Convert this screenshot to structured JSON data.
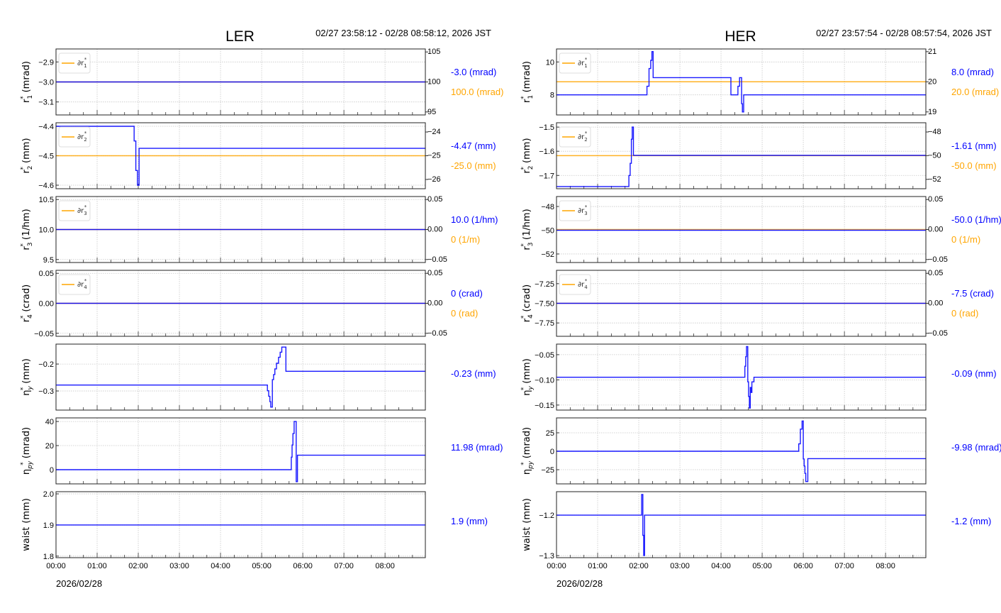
{
  "colors": {
    "value": "#0000ff",
    "reference": "#ffa500",
    "grid": "#c8c8c8"
  },
  "chart_data": [
    {
      "type": "line",
      "title": "LER",
      "time_range": "02/27 23:58:12 - 02/28 08:58:12, 2026 JST",
      "date_label": "2026/02/28",
      "xlim_hours": [
        0,
        8.98
      ],
      "xticks": [
        0,
        1,
        2,
        3,
        4,
        5,
        6,
        7,
        8
      ],
      "xticklabels": [
        "00:00",
        "01:00",
        "02:00",
        "03:00",
        "04:00",
        "05:00",
        "06:00",
        "07:00",
        "08:00"
      ],
      "panels": [
        {
          "ylabel": {
            "sym": "r",
            "sub": "1",
            "sup": "*",
            "unit": "(mrad)"
          },
          "ylim": [
            -3.165,
            -2.835
          ],
          "yticks": [
            -3.1,
            -3.0,
            -2.9
          ],
          "yticklabels": [
            "−3.1",
            "−3.0",
            "−2.9"
          ],
          "y2lim": [
            94.5,
            105.5
          ],
          "y2ticks": [
            95,
            100,
            105
          ],
          "y2ticklabels": [
            "95",
            "100",
            "105"
          ],
          "legend": {
            "sym": "∂r",
            "sub": "1",
            "sup": "*"
          },
          "value_series": [
            [
              0,
              -3.0
            ]
          ],
          "reference_value": 100,
          "readouts": [
            "-3.0 (mrad)",
            "100.0 (mrad)"
          ]
        },
        {
          "ylabel": {
            "sym": "r",
            "sub": "2",
            "sup": "*",
            "unit": "(mm)"
          },
          "ylim": [
            -4.612,
            -4.388
          ],
          "yticks": [
            -4.6,
            -4.5,
            -4.4
          ],
          "yticklabels": [
            "−4.6",
            "−4.5",
            "−4.4"
          ],
          "y2lim": [
            -26.39,
            -23.61
          ],
          "y2ticks": [
            -26,
            -25,
            -24
          ],
          "y2ticklabels": [
            "−26",
            "−25",
            "−24"
          ],
          "legend": {
            "sym": "∂r",
            "sub": "2",
            "sup": "*"
          },
          "value_series": [
            [
              0,
              -4.4
            ],
            [
              1.9,
              -4.45
            ],
            [
              1.94,
              -4.55
            ],
            [
              1.98,
              -4.6
            ],
            [
              2.02,
              -4.475
            ]
          ],
          "reference_value": -25,
          "readouts": [
            "-4.47 (mm)",
            "-25.0 (mm)"
          ]
        },
        {
          "ylabel": {
            "sym": "r",
            "sub": "3",
            "sup": "*",
            "unit": "(1/hm)"
          },
          "ylim": [
            9.45,
            10.55
          ],
          "yticks": [
            9.5,
            10.0,
            10.5
          ],
          "yticklabels": [
            "9.5",
            "10.0",
            "10.5"
          ],
          "y2lim": [
            -0.055,
            0.055
          ],
          "y2ticks": [
            -0.05,
            0,
            0.05
          ],
          "y2ticklabels": [
            "−0.05",
            "0.00",
            "0.05"
          ],
          "legend": {
            "sym": "∂r",
            "sub": "3",
            "sup": "*"
          },
          "value_series": [
            [
              0,
              10.0
            ]
          ],
          "reference_value": 0,
          "readouts": [
            "10.0 (1/hm)",
            "0 (1/m)"
          ]
        },
        {
          "ylabel": {
            "sym": "r",
            "sub": "4",
            "sup": "*",
            "unit": "(crad)"
          },
          "ylim": [
            -0.055,
            0.055
          ],
          "yticks": [
            -0.05,
            0,
            0.05
          ],
          "yticklabels": [
            "−0.05",
            "0.00",
            "0.05"
          ],
          "y2lim": [
            -0.055,
            0.055
          ],
          "y2ticks": [
            -0.05,
            0,
            0.05
          ],
          "y2ticklabels": [
            "−0.05",
            "0.00",
            "0.05"
          ],
          "legend": {
            "sym": "∂r",
            "sub": "4",
            "sup": "*"
          },
          "value_series": [
            [
              0,
              0
            ]
          ],
          "reference_value": 0,
          "readouts": [
            "0 (crad)",
            "0 (rad)"
          ]
        },
        {
          "ylabel": {
            "sym": "η",
            "sub": "y",
            "sup": "*",
            "unit": "(mm)"
          },
          "ylim": [
            -0.371,
            -0.126
          ],
          "yticks": [
            -0.3,
            -0.2
          ],
          "yticklabels": [
            "−0.3",
            "−0.2"
          ],
          "value_series": [
            [
              0,
              -0.278
            ],
            [
              5.14,
              -0.299
            ],
            [
              5.17,
              -0.32
            ],
            [
              5.2,
              -0.34
            ],
            [
              5.22,
              -0.36
            ],
            [
              5.26,
              -0.258
            ],
            [
              5.29,
              -0.239
            ],
            [
              5.32,
              -0.218
            ],
            [
              5.36,
              -0.197
            ],
            [
              5.41,
              -0.175
            ],
            [
              5.45,
              -0.156
            ],
            [
              5.49,
              -0.137
            ],
            [
              5.59,
              -0.227
            ]
          ],
          "readouts": [
            "-0.23 (mm)"
          ]
        },
        {
          "ylabel": {
            "sym": "η",
            "sub": "py",
            "sup": "*",
            "unit": "(mrad)"
          },
          "ylim": [
            -11.8,
            43
          ],
          "yticks": [
            0,
            20,
            40
          ],
          "yticklabels": [
            "0",
            "20",
            "40"
          ],
          "value_series": [
            [
              0,
              0
            ],
            [
              5.72,
              10.4
            ],
            [
              5.74,
              20.5
            ],
            [
              5.76,
              30
            ],
            [
              5.79,
              40
            ],
            [
              5.84,
              -10
            ],
            [
              5.87,
              11.98
            ]
          ],
          "readouts": [
            "11.98 (mrad)"
          ]
        },
        {
          "ylabel": {
            "sym": "waist",
            "sub": "",
            "sup": "",
            "unit": "(mm)"
          },
          "ylim": [
            1.795,
            2.007
          ],
          "yticks": [
            1.8,
            1.9,
            2.0
          ],
          "yticklabels": [
            "1.8",
            "1.9",
            "2.0"
          ],
          "value_series": [
            [
              0,
              1.9
            ]
          ],
          "readouts": [
            "1.9 (mm)"
          ]
        }
      ]
    },
    {
      "type": "line",
      "title": "HER",
      "time_range": "02/27 23:57:54 - 02/28 08:57:54, 2026 JST",
      "date_label": "2026/02/28",
      "xlim_hours": [
        0,
        8.98
      ],
      "xticks": [
        0,
        1,
        2,
        3,
        4,
        5,
        6,
        7,
        8
      ],
      "xticklabels": [
        "00:00",
        "01:00",
        "02:00",
        "03:00",
        "04:00",
        "05:00",
        "06:00",
        "07:00",
        "08:00"
      ],
      "panels": [
        {
          "ylabel": {
            "sym": "r",
            "sub": "1",
            "sup": "*",
            "unit": "(mrad)"
          },
          "ylim": [
            6.78,
            10.79
          ],
          "yticks": [
            8,
            10
          ],
          "yticklabels": [
            "8",
            "10"
          ],
          "y2lim": [
            18.9,
            21.09
          ],
          "y2ticks": [
            19,
            20,
            21
          ],
          "y2ticklabels": [
            "19",
            "20",
            "21"
          ],
          "legend": {
            "sym": "∂r",
            "sub": "1",
            "sup": "*"
          },
          "value_series": [
            [
              0,
              8
            ],
            [
              2.2,
              8.52
            ],
            [
              2.25,
              9.6
            ],
            [
              2.29,
              10.1
            ],
            [
              2.32,
              10.63
            ],
            [
              2.35,
              9.05
            ],
            [
              4.24,
              8
            ],
            [
              4.41,
              8.52
            ],
            [
              4.45,
              9.05
            ],
            [
              4.5,
              7.46
            ],
            [
              4.52,
              6.96
            ],
            [
              4.55,
              8
            ]
          ],
          "reference_value": 20,
          "readouts": [
            "8.0 (mrad)",
            "20.0 (mrad)"
          ]
        },
        {
          "ylabel": {
            "sym": "r",
            "sub": "2",
            "sup": "*",
            "unit": "(mm)"
          },
          "ylim": [
            -1.755,
            -1.482
          ],
          "yticks": [
            -1.7,
            -1.6,
            -1.5
          ],
          "yticklabels": [
            "−1.7",
            "−1.6",
            "−1.5"
          ],
          "y2lim": [
            -52.79,
            -47.22
          ],
          "y2ticks": [
            -52,
            -50,
            -48
          ],
          "y2ticklabels": [
            "−52",
            "−50",
            "−48"
          ],
          "legend": {
            "sym": "∂r",
            "sub": "2",
            "sup": "*"
          },
          "value_series": [
            [
              0,
              -1.746
            ],
            [
              1.76,
              -1.7
            ],
            [
              1.79,
              -1.65
            ],
            [
              1.82,
              -1.55
            ],
            [
              1.84,
              -1.5
            ],
            [
              1.87,
              -1.617
            ]
          ],
          "reference_value": -50,
          "readouts": [
            "-1.61 (mm)",
            "-50.0 (mm)"
          ]
        },
        {
          "ylabel": {
            "sym": "r",
            "sub": "3",
            "sup": "*",
            "unit": "(1/hm)"
          },
          "ylim": [
            -52.72,
            -47.16
          ],
          "yticks": [
            -52,
            -50,
            -48
          ],
          "yticklabels": [
            "−52",
            "−50",
            "−48"
          ],
          "y2lim": [
            -0.055,
            0.055
          ],
          "y2ticks": [
            -0.05,
            0,
            0.05
          ],
          "y2ticklabels": [
            "−0.05",
            "0.00",
            "0.05"
          ],
          "legend": {
            "sym": "∂r",
            "sub": "3",
            "sup": "*"
          },
          "value_series": [
            [
              0,
              -50
            ]
          ],
          "reference_value": 0,
          "readouts": [
            "-50.0 (1/hm)",
            "0 (1/m)"
          ]
        },
        {
          "ylabel": {
            "sym": "r",
            "sub": "4",
            "sup": "*",
            "unit": "(crad)"
          },
          "ylim": [
            -7.92,
            -7.08
          ],
          "yticks": [
            -7.75,
            -7.5,
            -7.25
          ],
          "yticklabels": [
            "−7.75",
            "−7.50",
            "−7.25"
          ],
          "y2lim": [
            -0.055,
            0.055
          ],
          "y2ticks": [
            -0.05,
            0,
            0.05
          ],
          "y2ticklabels": [
            "−0.05",
            "0.00",
            "0.05"
          ],
          "legend": {
            "sym": "∂r",
            "sub": "4",
            "sup": "*"
          },
          "value_series": [
            [
              0,
              -7.5
            ]
          ],
          "reference_value": 0,
          "readouts": [
            "-7.5 (crad)",
            "0 (rad)"
          ]
        },
        {
          "ylabel": {
            "sym": "η",
            "sub": "y",
            "sup": "*",
            "unit": "(mm)"
          },
          "ylim": [
            -0.16,
            -0.029
          ],
          "yticks": [
            -0.15,
            -0.1,
            -0.05
          ],
          "yticklabels": [
            "−0.15",
            "−0.10",
            "−0.05"
          ],
          "value_series": [
            [
              0,
              -0.0948
            ],
            [
              4.58,
              -0.073
            ],
            [
              4.6,
              -0.054
            ],
            [
              4.62,
              -0.034
            ],
            [
              4.65,
              -0.104
            ],
            [
              4.67,
              -0.133
            ],
            [
              4.69,
              -0.156
            ],
            [
              4.71,
              -0.115
            ],
            [
              4.73,
              -0.125
            ],
            [
              4.75,
              -0.104
            ],
            [
              4.8,
              -0.0948
            ]
          ],
          "readouts": [
            "-0.09 (mm)"
          ]
        },
        {
          "ylabel": {
            "sym": "η",
            "sub": "py",
            "sup": "*",
            "unit": "(mrad)"
          },
          "ylim": [
            -44.2,
            45.2
          ],
          "yticks": [
            -25,
            0,
            25
          ],
          "yticklabels": [
            "−25",
            "0",
            "25"
          ],
          "value_series": [
            [
              0,
              0
            ],
            [
              5.89,
              10
            ],
            [
              5.93,
              30
            ],
            [
              5.97,
              41
            ],
            [
              6.0,
              -10.5
            ],
            [
              6.02,
              -20
            ],
            [
              6.04,
              -30
            ],
            [
              6.06,
              -41
            ],
            [
              6.11,
              -9.98
            ]
          ],
          "readouts": [
            "-9.98 (mrad)"
          ]
        },
        {
          "ylabel": {
            "sym": "waist",
            "sub": "",
            "sup": "",
            "unit": "(mm)"
          },
          "ylim": [
            -1.305,
            -1.142
          ],
          "yticks": [
            -1.3,
            -1.2
          ],
          "yticklabels": [
            "−1.3",
            "−1.2"
          ],
          "value_series": [
            [
              0,
              -1.2
            ],
            [
              2.07,
              -1.149
            ],
            [
              2.1,
              -1.25
            ],
            [
              2.12,
              -1.3
            ],
            [
              2.14,
              -1.2
            ]
          ],
          "readouts": [
            "-1.2 (mm)"
          ]
        }
      ]
    }
  ]
}
